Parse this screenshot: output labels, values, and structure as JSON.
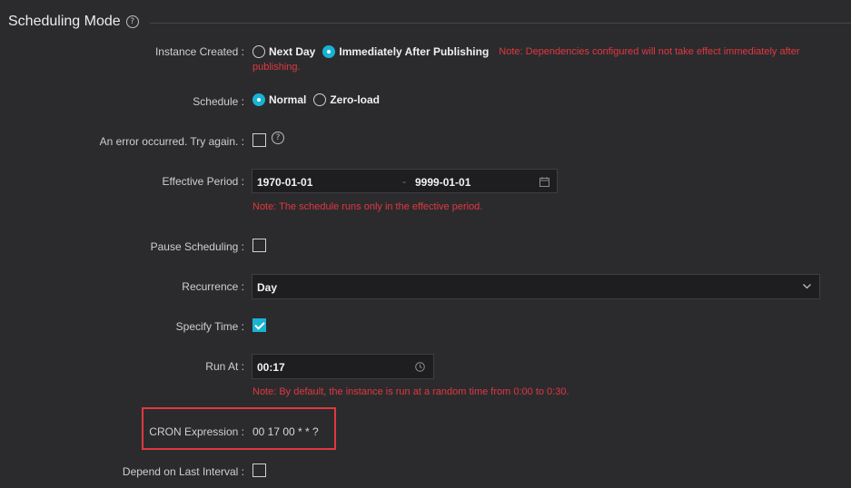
{
  "section": {
    "title": "Scheduling Mode"
  },
  "instance_created": {
    "label": "Instance Created :",
    "options": [
      "Next Day",
      "Immediately After Publishing"
    ],
    "selected": "Immediately After Publishing",
    "note_line1": "Note: Dependencies configured will not take effect immediately after",
    "note_line2": "publishing."
  },
  "schedule": {
    "label": "Schedule :",
    "options": [
      "Normal",
      "Zero-load"
    ],
    "selected": "Normal"
  },
  "error_row": {
    "label": "An error occurred. Try again. :"
  },
  "effective_period": {
    "label": "Effective Period :",
    "start": "1970-01-01",
    "separator": "-",
    "end": "9999-01-01",
    "note": "Note: The schedule runs only in the effective period."
  },
  "pause": {
    "label": "Pause Scheduling :"
  },
  "recurrence": {
    "label": "Recurrence :",
    "value": "Day"
  },
  "specify_time": {
    "label": "Specify Time :",
    "checked": true
  },
  "run_at": {
    "label": "Run At :",
    "value": "00:17",
    "note": "Note: By default, the instance is run at a random time from 0:00 to 0:30."
  },
  "cron": {
    "label": "CRON Expression :",
    "value": "00 17 00 * * ?"
  },
  "depend_last": {
    "label": "Depend on Last Interval :"
  },
  "colors": {
    "accent": "#19b3d3",
    "error": "#e0383e",
    "background": "#2b2b2e",
    "highlight_box": "#e0383e"
  }
}
